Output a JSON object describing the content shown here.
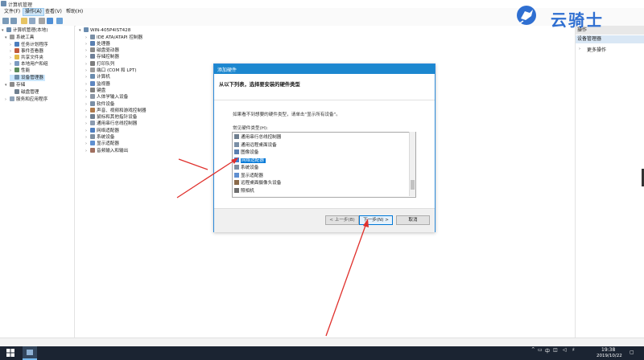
{
  "window": {
    "title": "计算机管理"
  },
  "menu": [
    "文件(F)",
    "操作(A)",
    "查看(V)",
    "帮助(H)"
  ],
  "logo": {
    "text": "云骑士"
  },
  "left_tree": {
    "items": [
      {
        "label": "计算机管理(本地)",
        "indent": 0,
        "arrow": "▾"
      },
      {
        "label": "系统工具",
        "indent": 1,
        "arrow": "▾"
      },
      {
        "label": "任务计划程序",
        "indent": 2,
        "arrow": "›"
      },
      {
        "label": "事件查看器",
        "indent": 2,
        "arrow": "›"
      },
      {
        "label": "共享文件夹",
        "indent": 2,
        "arrow": "›"
      },
      {
        "label": "本地用户和组",
        "indent": 2,
        "arrow": "›"
      },
      {
        "label": "性能",
        "indent": 2,
        "arrow": "›"
      },
      {
        "label": "设备管理器",
        "indent": 2,
        "arrow": ""
      },
      {
        "label": "存储",
        "indent": 1,
        "arrow": "▾"
      },
      {
        "label": "磁盘管理",
        "indent": 2,
        "arrow": ""
      },
      {
        "label": "服务和应用程序",
        "indent": 1,
        "arrow": "›"
      }
    ]
  },
  "devices": {
    "root": "WIN-405P4IST428",
    "items": [
      "IDE ATA/ATAPI 控制器",
      "处理器",
      "磁盘驱动器",
      "存储控制器",
      "打印队列",
      "端口 (COM 和 LPT)",
      "计算机",
      "监视器",
      "键盘",
      "人体学输入设备",
      "软件设备",
      "声音、视频和游戏控制器",
      "鼠标和其他指针设备",
      "通用串行总线控制器",
      "网络适配器",
      "系统设备",
      "显示适配器",
      "音频输入和输出"
    ]
  },
  "actions": {
    "header": "操作",
    "section": "设备管理器",
    "more": "更多操作"
  },
  "dialog": {
    "title": "添加硬件",
    "heading": "从以下列表，选择要安装的硬件类型",
    "hint": "如果看不到想要的硬件类型，请单击\"显示所有设备\"。",
    "list_label": "常见硬件类型(H):",
    "list_items": [
      "通用串行总线控制器",
      "通用远程桌面设备",
      "图像设备",
      "网络适配器",
      "系统设备",
      "显示适配器",
      "远程桌面摄像头设备",
      "照相机"
    ],
    "selected_index": 3,
    "buttons": {
      "back": "< 上一步(B)",
      "next": "下一步(N) >",
      "cancel": "取消"
    }
  },
  "taskbar": {
    "tray": "中",
    "time": "19:38",
    "date": "2019/10/22"
  },
  "colors": {
    "dialog_title": "#1c87cf",
    "selection": "#0078d7",
    "arrow": "#e0302c",
    "logo": "#2f6fd1",
    "taskbar": "#1b2432"
  }
}
